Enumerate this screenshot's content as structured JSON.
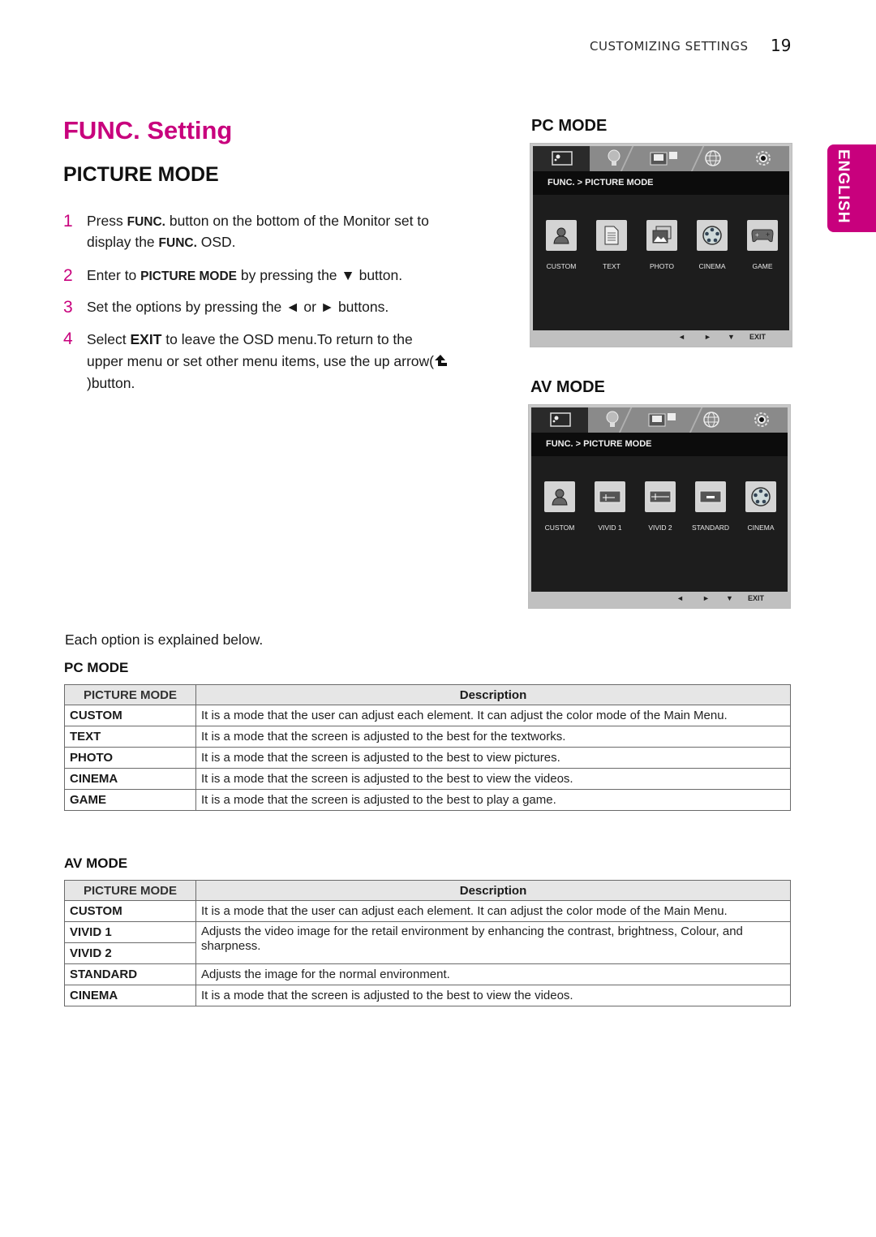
{
  "header": {
    "running_title": "CUSTOMIZING SETTINGS",
    "page_number": "19"
  },
  "language_tab": "ENGLISH",
  "title": "FUNC. Setting",
  "subtitle": "PICTURE MODE",
  "steps": [
    {
      "num": "1",
      "parts": [
        "Press ",
        "FUNC.",
        " button on   the bottom of the Monitor set to display the ",
        "FUNC.",
        " OSD."
      ]
    },
    {
      "num": "2",
      "parts": [
        "Enter to ",
        "PICTURE MODE",
        " by pressing the ▼ button."
      ]
    },
    {
      "num": "3",
      "text": "Set the options by pressing the ◄ or ► buttons."
    },
    {
      "num": "4",
      "parts": [
        "Select ",
        "EXIT",
        " to leave the OSD menu.To return to the upper menu or set other menu items, use  the up arrow(",
        ")button."
      ]
    }
  ],
  "osd_sections": {
    "pc": {
      "label": "PC MODE",
      "breadcrumb": "FUNC.  >  PICTURE MODE",
      "items": [
        "CUSTOM",
        "TEXT",
        "PHOTO",
        "CINEMA",
        "GAME"
      ],
      "icons": [
        "person-icon",
        "document-icon",
        "photo-icon",
        "film-reel-icon",
        "gamepad-icon"
      ],
      "nav": [
        "◄",
        "►",
        "▼",
        "EXIT"
      ]
    },
    "av": {
      "label": "AV MODE",
      "breadcrumb": "FUNC.  >  PICTURE MODE",
      "items": [
        "CUSTOM",
        "VIVID 1",
        "VIVID 2",
        "STANDARD",
        "CINEMA"
      ],
      "icons": [
        "person-icon",
        "vivid1-icon",
        "vivid2-icon",
        "standard-icon",
        "film-reel-icon"
      ],
      "nav": [
        "◄",
        "►",
        "▼",
        "EXIT"
      ]
    }
  },
  "explain_text": "Each option is explained below.",
  "tables": {
    "pc": {
      "label": "PC MODE",
      "headers": [
        "PICTURE MODE",
        "Description"
      ],
      "rows": [
        [
          "CUSTOM",
          "It is a mode that the user can adjust each element. It can adjust the color mode of the Main Menu."
        ],
        [
          "TEXT",
          "It is a mode that the screen is adjusted to the best for the textworks."
        ],
        [
          "PHOTO",
          "It is a mode that the screen is adjusted to the best to view pictures."
        ],
        [
          "CINEMA",
          "It is a mode that the screen is adjusted to the best to view the videos."
        ],
        [
          "GAME",
          "It is a mode that the screen is adjusted to the best to play a game."
        ]
      ]
    },
    "av": {
      "label": "AV MODE",
      "headers": [
        "PICTURE MODE",
        "Description"
      ],
      "rows": [
        [
          "CUSTOM",
          "It is a mode that the user can adjust each element. It can adjust the color mode of the Main Menu."
        ],
        [
          "VIVID 1",
          "Adjusts the video image for the retail environment by enhancing the contrast, brightness, Colour, and sharpness."
        ],
        [
          "VIVID 2",
          ""
        ],
        [
          "STANDARD",
          "Adjusts the image for the normal environment."
        ],
        [
          "CINEMA",
          "It is a mode that the screen is adjusted to the best to view the videos."
        ]
      ]
    }
  }
}
